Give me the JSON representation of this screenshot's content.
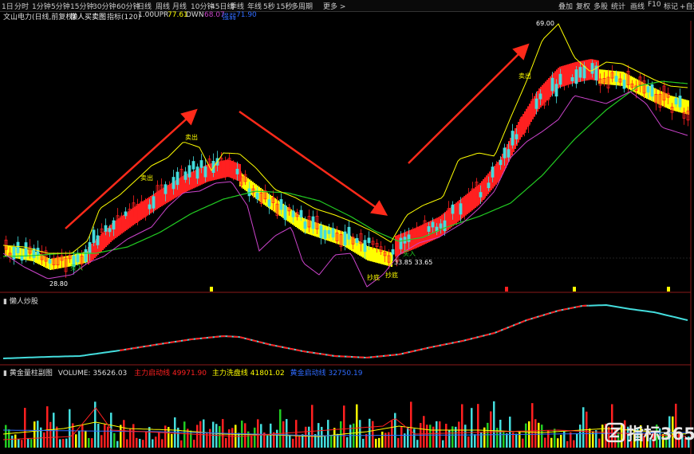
{
  "toolbar": {
    "items": [
      "1日",
      "分时",
      "1分钟",
      "5分钟",
      "15分钟",
      "30分钟",
      "60分钟",
      "日线",
      "周线",
      "月线",
      "10分钟",
      "45日线",
      "季线",
      "年线",
      "5秒",
      "15秒",
      "多周期",
      "更多 >"
    ],
    "right_items": [
      "叠加",
      "复权",
      "多股",
      "统计",
      "画线",
      "F10",
      "标记",
      "+自选"
    ]
  },
  "info": {
    "stock_name": "文山电力(日线,前复权)",
    "indicator_name": "懒人买卖图",
    "params_label": "指标(120)",
    "params_value": "1.00",
    "upr_label": "UPR",
    "upr_value": "77.61",
    "dwn_label": "DWN",
    "dwn_value": "68.07",
    "mid_label": "强弱",
    "mid_value": "71.90"
  },
  "annotations": {
    "high_price": "69.00",
    "low_price": "28.80",
    "mid_price": "33.85 33.65",
    "buy_text": "买入",
    "sell_text": "卖出",
    "bottom_text": "抄底"
  },
  "panel2": {
    "title": "懒人炒股"
  },
  "panel3": {
    "title": "黄金量柱副图",
    "volume_label": "VOLUME:",
    "volume_value": "35626.03",
    "line1_label": "主力启动线",
    "line1_value": "49971.90",
    "line2_label": "主力洗盘线",
    "line2_value": "41801.02",
    "line3_label": "黄金启动线",
    "line3_value": "32750.19"
  },
  "watermark": {
    "brand": "指标365"
  },
  "colors": {
    "red": "#ff2020",
    "yellow": "#ffff00",
    "green": "#22cc22",
    "magenta": "#cc44cc",
    "cyan": "#44dddd",
    "arrow": "#ff2a1a"
  }
}
